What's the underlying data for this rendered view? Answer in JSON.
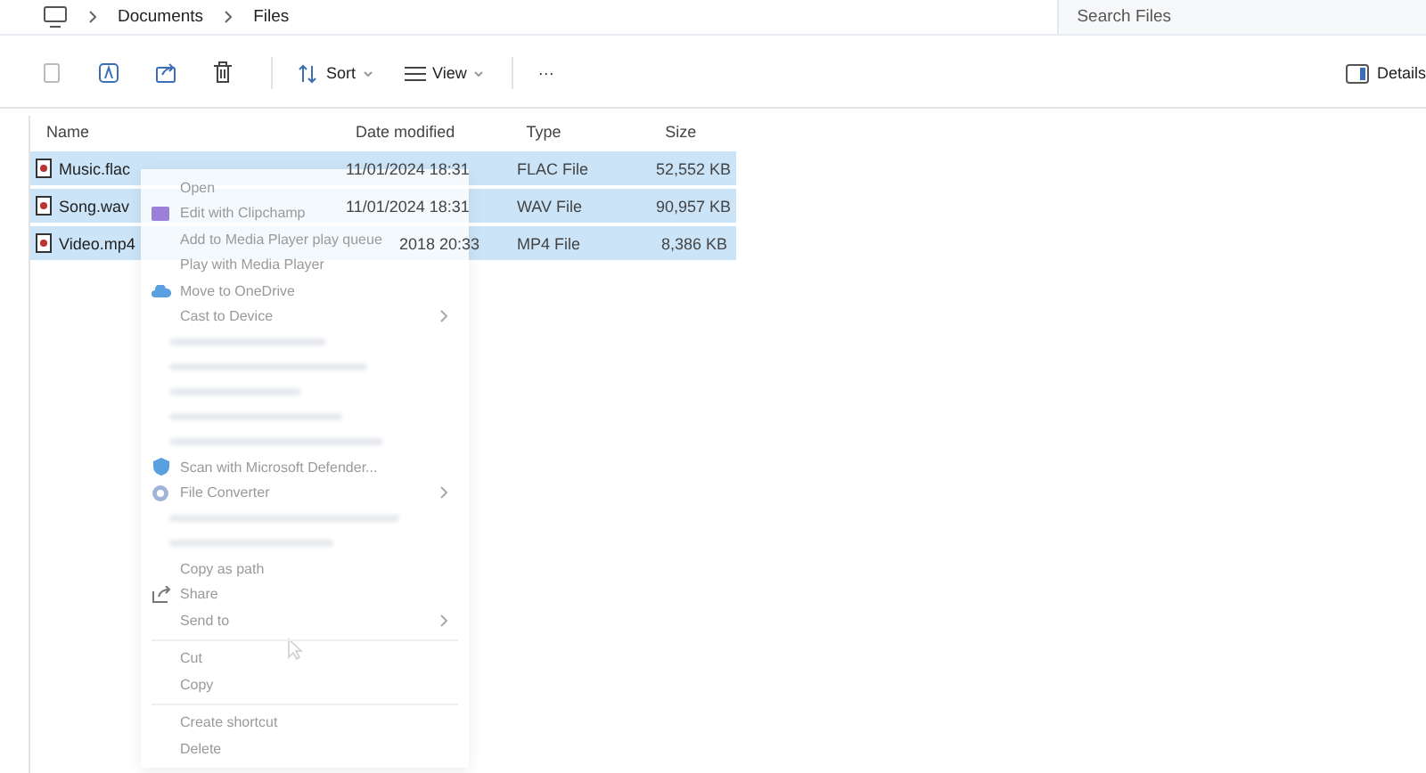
{
  "breadcrumb": [
    "Documents",
    "Files"
  ],
  "search": {
    "placeholder": "Search Files"
  },
  "toolbar": {
    "sort": "Sort",
    "view": "View",
    "more": "···",
    "details": "Details"
  },
  "table": {
    "columns": [
      "Name",
      "Date modified",
      "Type",
      "Size"
    ],
    "rows": [
      {
        "name": "Music.flac",
        "date": "11/01/2024 18:31",
        "type": "FLAC File",
        "size": "52,552 KB",
        "selected": true
      },
      {
        "name": "Song.wav",
        "date": "11/01/2024 18:31",
        "type": "WAV File",
        "size": "90,957 KB",
        "selected": true
      },
      {
        "name": "Video.mp4",
        "date": "2018 20:33",
        "type": "MP4 File",
        "size": "8,386 KB",
        "selected": true
      }
    ]
  },
  "context_menu": {
    "items": [
      {
        "kind": "item",
        "label": "Open"
      },
      {
        "kind": "item",
        "label": "Edit with Clipchamp"
      },
      {
        "kind": "item",
        "label": "Add to Media Player play queue"
      },
      {
        "kind": "item",
        "label": "Play with Media Player"
      },
      {
        "kind": "item",
        "label": "Move to OneDrive"
      },
      {
        "kind": "item",
        "label": "Cast to Device",
        "submenu": true
      },
      {
        "kind": "blurred"
      },
      {
        "kind": "blurred"
      },
      {
        "kind": "blurred"
      },
      {
        "kind": "blurred"
      },
      {
        "kind": "blurred"
      },
      {
        "kind": "item",
        "label": "Scan with Microsoft Defender..."
      },
      {
        "kind": "item",
        "label": "File Converter",
        "submenu": true
      },
      {
        "kind": "blurred"
      },
      {
        "kind": "blurred"
      },
      {
        "kind": "item",
        "label": "Copy as path"
      },
      {
        "kind": "item",
        "label": "Share"
      },
      {
        "kind": "item",
        "label": "Send to",
        "submenu": true
      },
      {
        "kind": "separator"
      },
      {
        "kind": "item",
        "label": "Cut"
      },
      {
        "kind": "item",
        "label": "Copy"
      },
      {
        "kind": "separator"
      },
      {
        "kind": "item",
        "label": "Create shortcut"
      },
      {
        "kind": "item",
        "label": "Delete"
      }
    ]
  }
}
